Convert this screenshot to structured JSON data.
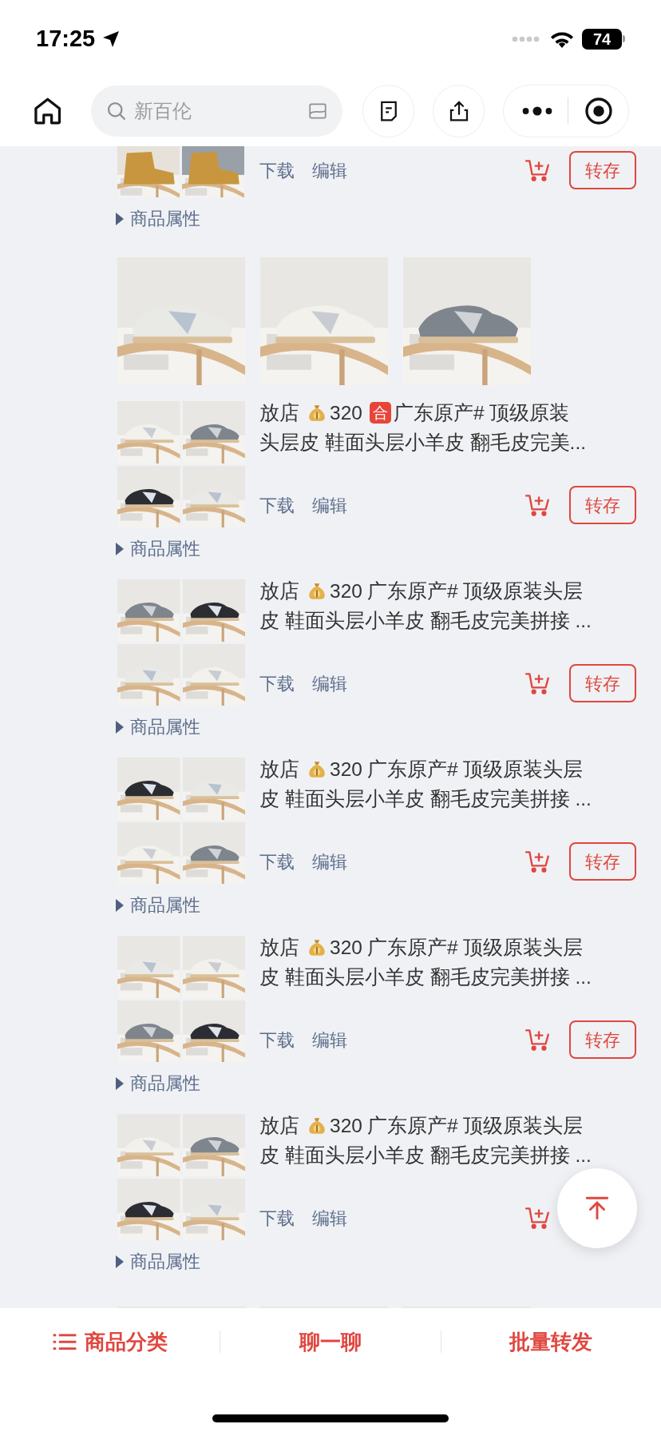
{
  "status_bar": {
    "time": "17:25",
    "battery": "74"
  },
  "nav": {
    "search": {
      "placeholder": "新百伦"
    }
  },
  "items": [
    {
      "kind": "partial",
      "actions": [
        "下载",
        "编辑"
      ],
      "save_label": "转存",
      "attributes_label": "商品属性"
    },
    {
      "kind": "gallery"
    },
    {
      "kind": "product",
      "title": {
        "line_1": [
          {
            "kind": "text",
            "text": "放店"
          },
          {
            "kind": "money_bag"
          },
          {
            "kind": "text",
            "text": "320"
          },
          {
            "kind": "badge",
            "text": "合"
          },
          {
            "kind": "text",
            "text": "广东原产# 顶级原装"
          }
        ],
        "line_2": "头层皮 鞋面头层小羊皮 翻毛皮完美..."
      },
      "actions": [
        "下载",
        "编辑"
      ],
      "save_label": "转存",
      "attributes_label": "商品属性"
    },
    {
      "kind": "product",
      "title": {
        "line_1": [
          {
            "kind": "text",
            "text": "放店"
          },
          {
            "kind": "money_bag"
          },
          {
            "kind": "text",
            "text": "320"
          },
          {
            "kind": "text",
            "text": "广东原产# 顶级原装头层"
          }
        ],
        "line_2": "皮 鞋面头层小羊皮 翻毛皮完美拼接 ..."
      },
      "actions": [
        "下载",
        "编辑"
      ],
      "save_label": "转存",
      "attributes_label": "商品属性"
    },
    {
      "kind": "product",
      "title": {
        "line_1": [
          {
            "kind": "text",
            "text": "放店"
          },
          {
            "kind": "money_bag"
          },
          {
            "kind": "text",
            "text": "320"
          },
          {
            "kind": "text",
            "text": "广东原产# 顶级原装头层"
          }
        ],
        "line_2": "皮 鞋面头层小羊皮 翻毛皮完美拼接 ..."
      },
      "actions": [
        "下载",
        "编辑"
      ],
      "save_label": "转存",
      "attributes_label": "商品属性"
    },
    {
      "kind": "product",
      "title": {
        "line_1": [
          {
            "kind": "text",
            "text": "放店"
          },
          {
            "kind": "money_bag"
          },
          {
            "kind": "text",
            "text": "320"
          },
          {
            "kind": "text",
            "text": "广东原产# 顶级原装头层"
          }
        ],
        "line_2": "皮 鞋面头层小羊皮 翻毛皮完美拼接 ..."
      },
      "actions": [
        "下载",
        "编辑"
      ],
      "save_label": "转存",
      "attributes_label": "商品属性"
    },
    {
      "kind": "product",
      "title": {
        "line_1": [
          {
            "kind": "text",
            "text": "放店"
          },
          {
            "kind": "money_bag"
          },
          {
            "kind": "text",
            "text": "320"
          },
          {
            "kind": "text",
            "text": "广东原产# 顶级原装头层"
          }
        ],
        "line_2": "皮 鞋面头层小羊皮 翻毛皮完美拼接 ..."
      },
      "actions": [
        "下载",
        "编辑"
      ],
      "attributes_label": "商品属性"
    },
    {
      "kind": "gallery"
    }
  ],
  "bottom_bar": [
    {
      "kind": "category",
      "label": "商品分类"
    },
    {
      "kind": "plain",
      "label": "聊一聊"
    },
    {
      "kind": "plain",
      "label": "批量转发"
    }
  ]
}
